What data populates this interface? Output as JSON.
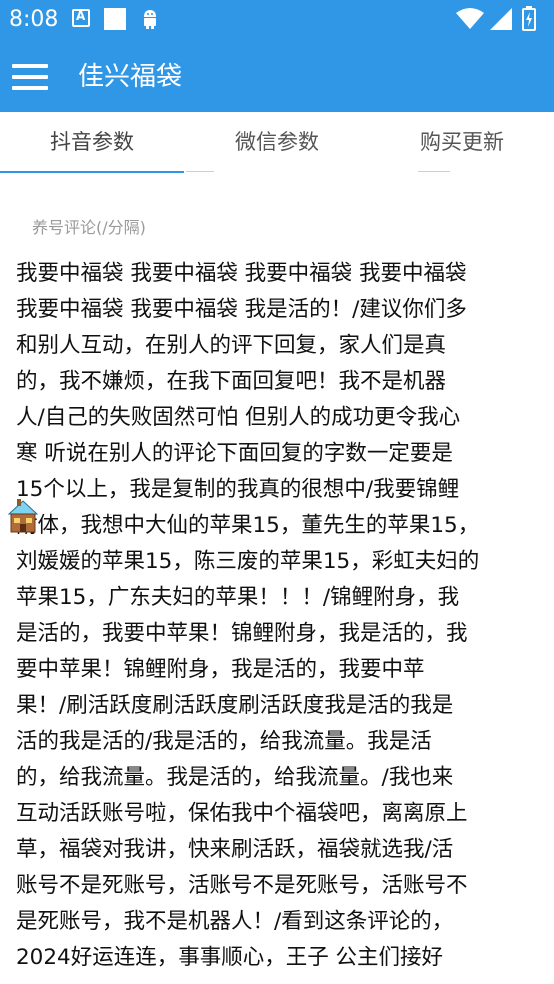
{
  "status_bar": {
    "time": "8:08",
    "left_icons": [
      "a-notification-icon",
      "white-square-icon",
      "android-icon"
    ],
    "right_icons": [
      "wifi-icon",
      "signal-icon",
      "battery-charging-icon"
    ]
  },
  "app_bar": {
    "title": "佳兴福袋",
    "menu_icon": "hamburger-menu-icon"
  },
  "tabs": [
    {
      "label": "抖音参数",
      "active": true
    },
    {
      "label": "微信参数",
      "active": false
    },
    {
      "label": "购买更新",
      "active": false
    }
  ],
  "comment_field": {
    "label": "养号评论(/分隔)",
    "lines": [
      "我要中福袋 我要中福袋 我要中福袋 我要中福袋",
      "我要中福袋 我要中福袋 我是活的！/建议你们多",
      "和别人互动，在别人的评下回复，家人们是真",
      "的，我不嫌烦，在我下面回复吧！我不是机器",
      "人/自己的失败固然可怕 但别人的成功更令我心",
      "寒 听说在别人的评论下面回复的字数一定要是",
      "15个以上，我是复制的我真的很想中/我要锦鲤",
      "附体，我想中大仙的苹果15，董先生的苹果15，",
      "刘媛媛的苹果15，陈三废的苹果15，彩虹夫妇的",
      "苹果15，广东夫妇的苹果！！！/锦鲤附身，我",
      "是活的，我要中苹果！锦鲤附身，我是活的，我",
      "要中苹果！锦鲤附身，我是活的，我要中苹",
      "果！/刷活跃度刷活跃度刷活跃度我是活的我是",
      "活的我是活的/我是活的，给我流量。我是活",
      "的，给我流量。我是活的，给我流量。/我也来",
      "互动活跃账号啦，保佑我中个福袋吧，离离原上",
      "草，福袋对我讲，快来刷活跃，福袋就选我/活",
      "账号不是死账号，活账号不是死账号，活账号不",
      "是死账号，我不是机器人！/看到这条评论的，",
      "2024好运连连，事事顺心，王子 公主们接好"
    ]
  },
  "floating_icon": "house-icon",
  "colors": {
    "primary": "#2f97e6",
    "tab_text": "#555555",
    "label_text": "#9a9a9a",
    "body_text": "#111111"
  }
}
